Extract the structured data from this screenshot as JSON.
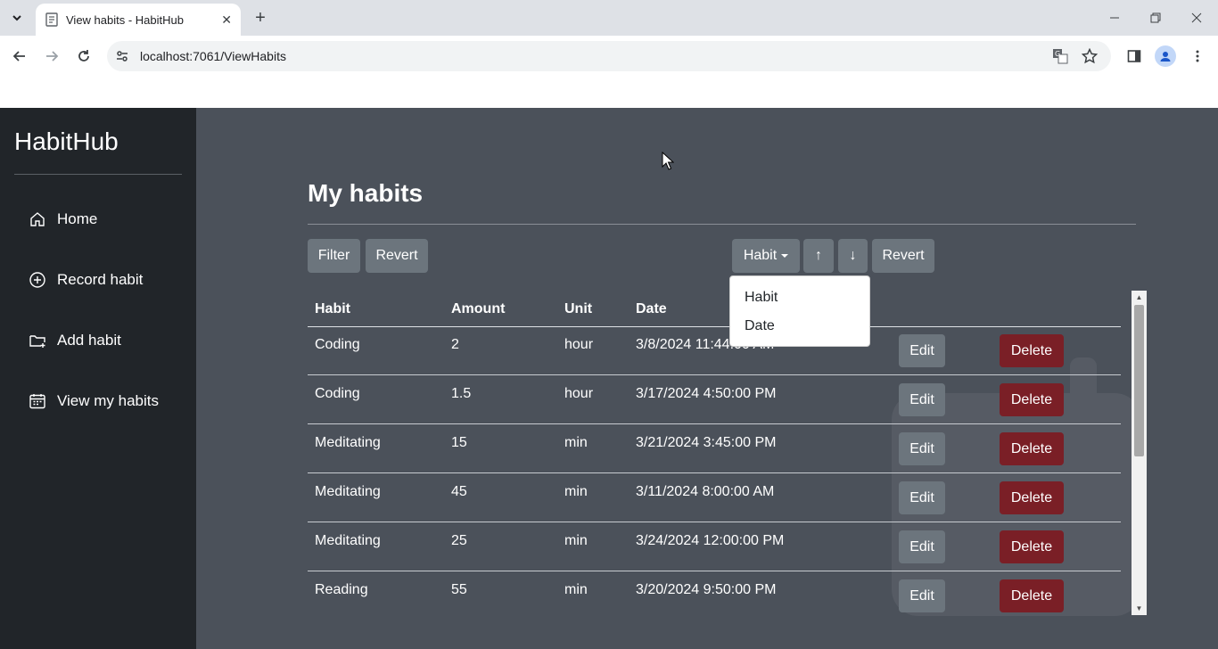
{
  "browser": {
    "tab_title": "View habits - HabitHub",
    "url": "localhost:7061/ViewHabits"
  },
  "sidebar": {
    "brand": "HabitHub",
    "items": [
      {
        "label": "Home",
        "icon": "house-icon"
      },
      {
        "label": "Record habit",
        "icon": "plus-circle-icon"
      },
      {
        "label": "Add habit",
        "icon": "folder-plus-icon"
      },
      {
        "label": "View my habits",
        "icon": "calendar-icon"
      }
    ]
  },
  "main": {
    "title": "My habits",
    "filter_label": "Filter",
    "revert_label": "Revert",
    "sort_select_label": "Habit",
    "sort_asc_label": "↑",
    "sort_desc_label": "↓",
    "sort_revert_label": "Revert",
    "dropdown_options": [
      "Habit",
      "Date"
    ],
    "columns": [
      "Habit",
      "Amount",
      "Unit",
      "Date"
    ],
    "rows": [
      {
        "habit": "Coding",
        "amount": "2",
        "unit": "hour",
        "date": "3/8/2024 11:44:00 AM"
      },
      {
        "habit": "Coding",
        "amount": "1.5",
        "unit": "hour",
        "date": "3/17/2024 4:50:00 PM"
      },
      {
        "habit": "Meditating",
        "amount": "15",
        "unit": "min",
        "date": "3/21/2024 3:45:00 PM"
      },
      {
        "habit": "Meditating",
        "amount": "45",
        "unit": "min",
        "date": "3/11/2024 8:00:00 AM"
      },
      {
        "habit": "Meditating",
        "amount": "25",
        "unit": "min",
        "date": "3/24/2024 12:00:00 PM"
      },
      {
        "habit": "Reading",
        "amount": "55",
        "unit": "min",
        "date": "3/20/2024 9:50:00 PM"
      }
    ],
    "edit_label": "Edit",
    "delete_label": "Delete"
  },
  "colors": {
    "sidebar_bg": "#212529",
    "main_bg": "#4b515a",
    "secondary_btn": "#6c757d",
    "danger_btn": "#7a1f26"
  }
}
